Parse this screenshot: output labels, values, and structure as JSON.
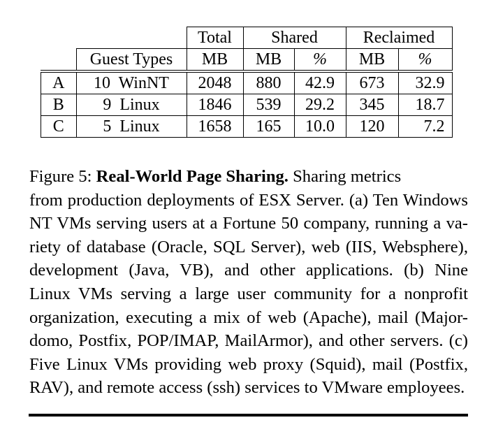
{
  "table": {
    "header_top": {
      "total": "Total",
      "shared": "Shared",
      "reclaimed": "Reclaimed"
    },
    "header_sub": {
      "guest_types": "Guest Types",
      "total_mb": "MB",
      "shared_mb": "MB",
      "shared_pct": "%",
      "reclaimed_mb": "MB",
      "reclaimed_pct": "%"
    },
    "rows": [
      {
        "label": "A",
        "guest": "10  WinNT",
        "total": "2048",
        "shared_mb": "880",
        "shared_pct": "42.9",
        "reclaimed_mb": "673",
        "reclaimed_pct": "32.9"
      },
      {
        "label": "B",
        "guest": "9  Linux",
        "total": "1846",
        "shared_mb": "539",
        "shared_pct": "29.2",
        "reclaimed_mb": "345",
        "reclaimed_pct": "18.7"
      },
      {
        "label": "C",
        "guest": "5  Linux",
        "total": "1658",
        "shared_mb": "165",
        "shared_pct": "10.0",
        "reclaimed_mb": "120",
        "reclaimed_pct": "7.2"
      }
    ]
  },
  "caption": {
    "prefix": "Figure 5: ",
    "title": "Real-World Page Sharing.",
    "body_lines": [
      "  Sharing metrics",
      "from production deployments of ESX Server. (a) Ten Windows",
      "NT VMs serving users at a Fortune 50 company, running a va-",
      "riety of database (Oracle, SQL Server), web (IIS, Websphere),",
      "development (Java, VB), and other applications.  (b) Nine",
      "Linux VMs serving a large user community for a nonprofit",
      "organization, executing a mix of web (Apache), mail (Major-",
      "domo, Postfix, POP/IMAP, MailArmor), and other servers. (c)",
      "Five Linux VMs providing web proxy (Squid), mail (Postfix,",
      "RAV), and remote access (ssh) services to VMware employees."
    ]
  }
}
